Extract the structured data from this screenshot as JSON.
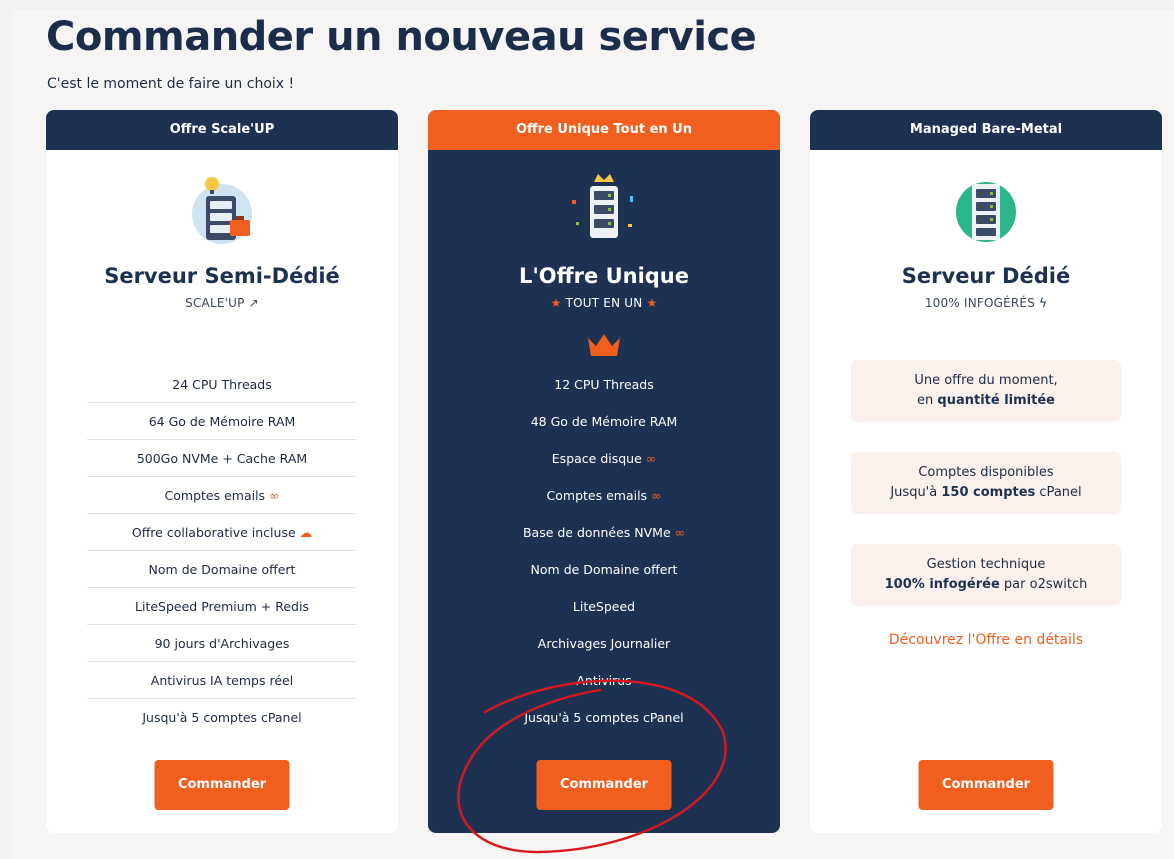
{
  "page": {
    "title": "Commander un nouveau service",
    "subtitle": "C'est le moment de faire un choix !"
  },
  "colors": {
    "navy": "#1d3252",
    "orange": "#f15f1e",
    "annotation_red": "#d9161c"
  },
  "cards": [
    {
      "header": "Offre Scale'UP",
      "icon": "server-lightbulb-briefcase-icon",
      "name": "Serveur Semi-Dédié",
      "tag": "SCALE'UP",
      "tag_icon": "trending-up-icon",
      "features": [
        "24 CPU Threads",
        "64 Go de Mémoire RAM",
        "500Go NVMe + Cache RAM",
        "Comptes emails",
        "Offre collaborative incluse",
        "Nom de Domaine offert",
        "LiteSpeed Premium + Redis",
        "90 jours d'Archivages",
        "Antivirus IA temps réel",
        "Jusqu'à 5 comptes cPanel"
      ],
      "button": "Commander"
    },
    {
      "header": "Offre Unique Tout en Un",
      "icon": "server-crown-confetti-icon",
      "name": "L'Offre Unique",
      "tag": "TOUT EN UN",
      "tag_icon": "star-icon",
      "badge_icon": "crown-icon",
      "features": [
        "12 CPU Threads",
        "48 Go de Mémoire RAM",
        "Espace disque",
        "Comptes emails",
        "Base de données NVMe",
        "Nom de Domaine offert",
        "LiteSpeed",
        "Archivages Journalier",
        "Antivirus",
        "Jusqu'à 5 comptes cPanel"
      ],
      "button": "Commander"
    },
    {
      "header": "Managed Bare-Metal",
      "icon": "server-green-icon",
      "name": "Serveur Dédié",
      "tag": "100% INFOGÉRÉS",
      "tag_icon": "lightning-icon",
      "info_boxes": [
        {
          "line1": "Une offre du moment,",
          "line2_pre": "en ",
          "line2_bold": "quantité limitée",
          "line2_post": ""
        },
        {
          "line1": "Comptes disponibles",
          "line2_pre": "Jusqu'à ",
          "line2_bold": "150 comptes",
          "line2_post": " cPanel"
        },
        {
          "line1": "Gestion technique",
          "line2_pre": "",
          "line2_bold": "100% infogérée",
          "line2_post": " par o2switch"
        }
      ],
      "link": "Découvrez l'Offre en détails",
      "button": "Commander"
    }
  ]
}
